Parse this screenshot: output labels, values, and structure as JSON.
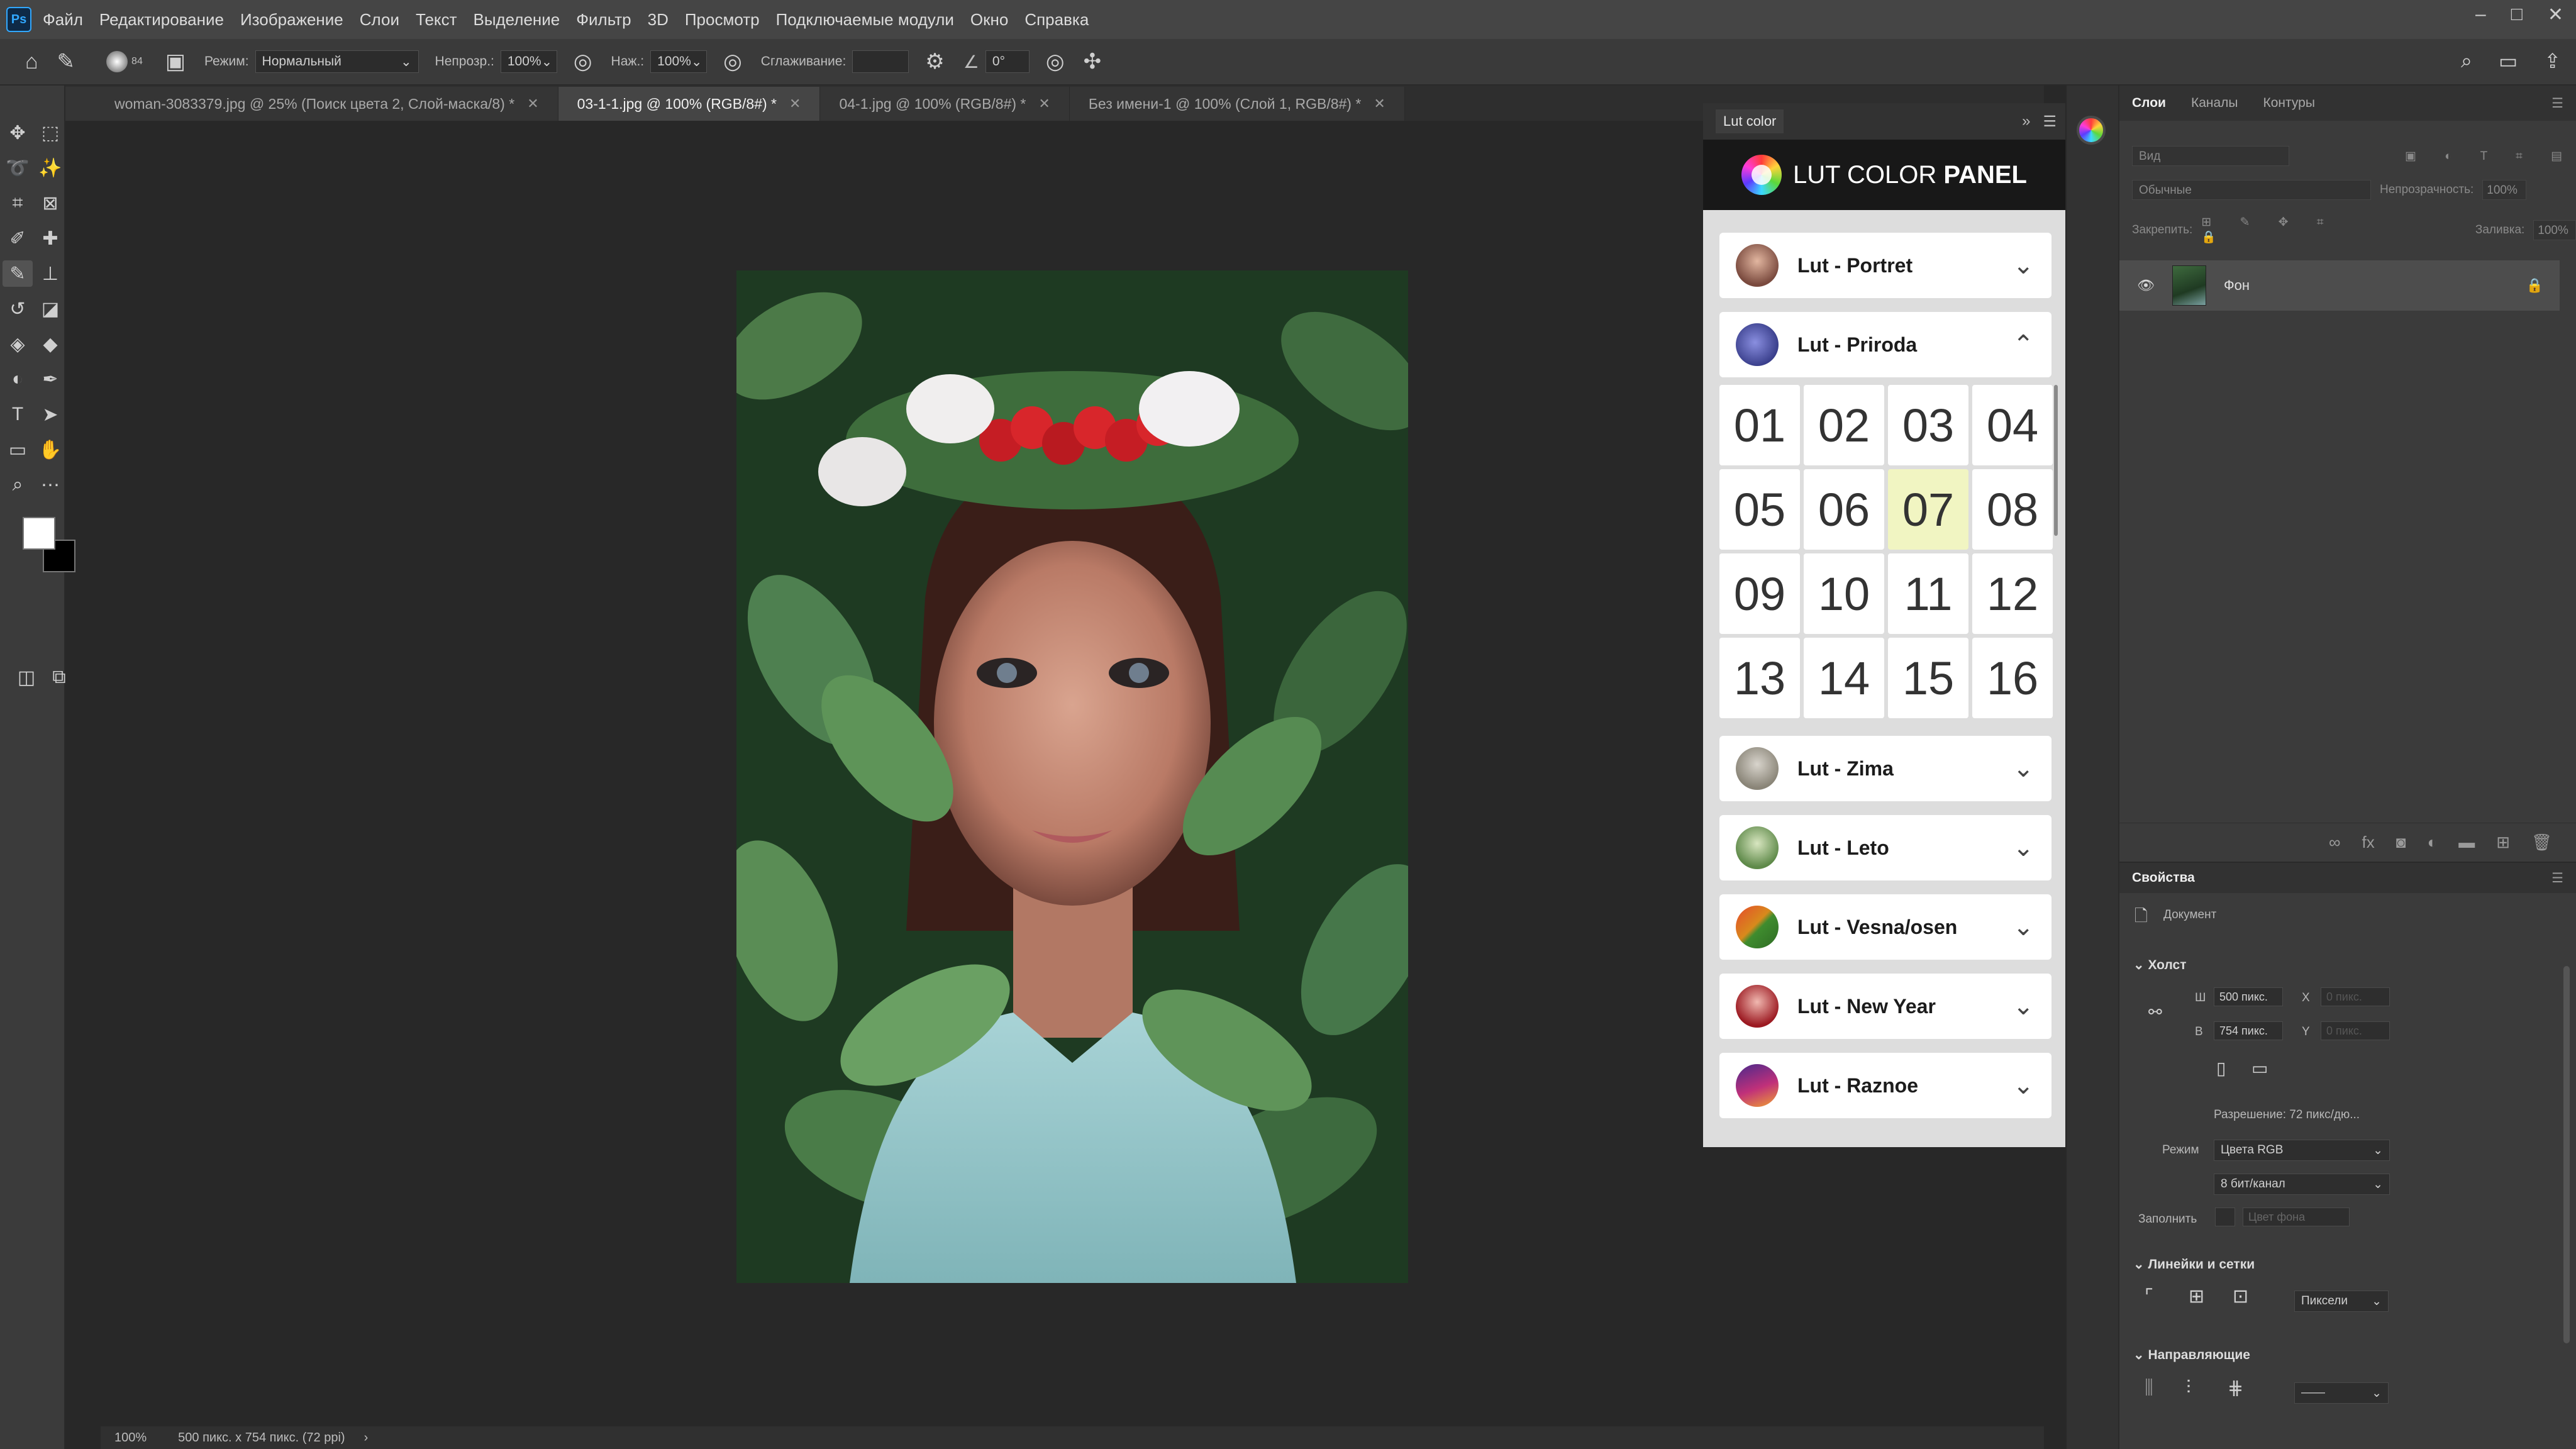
{
  "app": {
    "logo": "Ps"
  },
  "menu": [
    "Файл",
    "Редактирование",
    "Изображение",
    "Слои",
    "Текст",
    "Выделение",
    "Фильтр",
    "3D",
    "Просмотр",
    "Подключаемые модули",
    "Окно",
    "Справка"
  ],
  "window_controls": {
    "minimize": "–",
    "maximize": "□",
    "close": "✕"
  },
  "options": {
    "brush_size": "84",
    "mode_label": "Режим:",
    "mode_value": "Нормальный",
    "opacity_label": "Непрозр.:",
    "opacity_value": "100%",
    "pressure_label": "Наж.:",
    "pressure_value": "100%",
    "smoothing_label": "Сглаживание:",
    "angle_value": "0°"
  },
  "doc_tabs": [
    {
      "label": "woman-3083379.jpg @ 25% (Поиск цвета 2, Слой-маска/8) *",
      "active": false
    },
    {
      "label": "03-1-1.jpg @ 100% (RGB/8#) *",
      "active": true
    },
    {
      "label": "04-1.jpg @ 100% (RGB/8#) *",
      "active": false
    },
    {
      "label": "Без имени-1 @ 100% (Слой 1, RGB/8#) *",
      "active": false
    }
  ],
  "status": {
    "zoom": "100%",
    "doc_info": "500 пикс. x 754 пикс. (72 ppi)",
    "arrow": "›"
  },
  "lut_panel": {
    "tab_label": "Lut color",
    "title_light": "LUT COLOR",
    "title_bold": "PANEL",
    "sections": [
      {
        "label": "Lut - Portret",
        "expanded": false
      },
      {
        "label": "Lut - Priroda",
        "expanded": true
      },
      {
        "label": "Lut - Zima",
        "expanded": false
      },
      {
        "label": "Lut - Leto",
        "expanded": false
      },
      {
        "label": "Lut - Vesna/osen",
        "expanded": false
      },
      {
        "label": "Lut - New Year",
        "expanded": false
      },
      {
        "label": "Lut - Raznoe",
        "expanded": false
      }
    ],
    "presets": [
      "01",
      "02",
      "03",
      "04",
      "05",
      "06",
      "07",
      "08",
      "09",
      "10",
      "11",
      "12",
      "13",
      "14",
      "15",
      "16"
    ],
    "selected_preset": "07"
  },
  "layers": {
    "tabs": [
      "Слои",
      "Каналы",
      "Контуры"
    ],
    "search_placeholder": "Вид",
    "blend_mode": "Обычные",
    "opacity_label": "Непрозрачность:",
    "opacity_value": "100%",
    "lock_label": "Закрепить:",
    "fill_label": "Заливка:",
    "fill_value": "100%",
    "layer_name": "Фон"
  },
  "properties": {
    "title": "Свойства",
    "doc_label": "Документ",
    "canvas_section": "Холст",
    "w_label": "Ш",
    "w_value": "500 пикс.",
    "h_label": "В",
    "h_value": "754 пикс.",
    "x_label": "X",
    "x_value": "0 пикс.",
    "y_label": "Y",
    "y_value": "0 пикс.",
    "resolution": "Разрешение: 72 пикс/дю...",
    "mode_label": "Режим",
    "mode_value": "Цвета RGB",
    "depth_value": "8 бит/канал",
    "fill_label": "Заполнить",
    "fill_value": "Цвет фона",
    "rulers_section": "Линейки и сетки",
    "units_value": "Пиксели",
    "guides_section": "Направляющие"
  },
  "colors": {
    "accent": "#31a8ff",
    "selected_cell": "#f1f5c2",
    "panel_bg": "#dddddd"
  }
}
